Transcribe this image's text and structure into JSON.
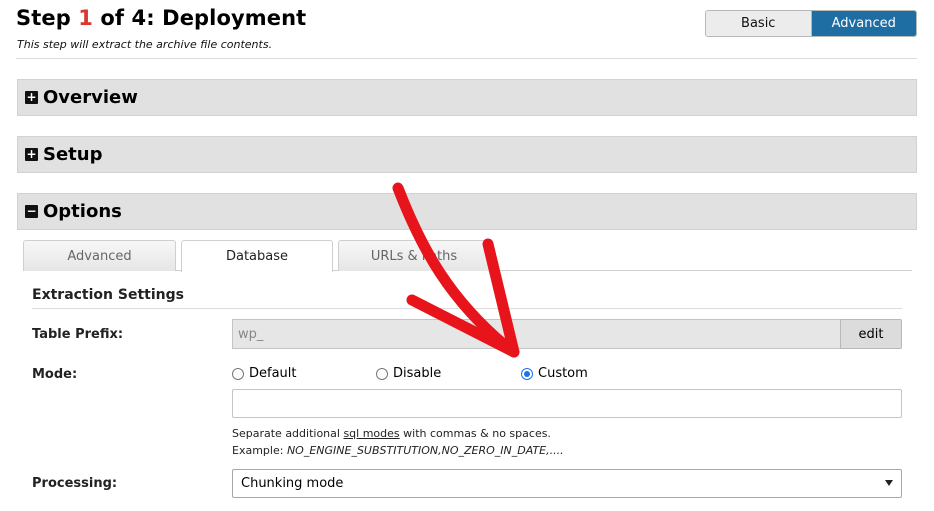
{
  "header": {
    "step_prefix": "Step ",
    "step_num": "1",
    "step_suffix": " of 4: Deployment",
    "subtitle": "This step will extract the archive file contents."
  },
  "mode_toggle": {
    "basic": "Basic",
    "advanced": "Advanced",
    "active": "Advanced"
  },
  "sections": {
    "overview": {
      "icon": "+",
      "label": "Overview"
    },
    "setup": {
      "icon": "+",
      "label": "Setup"
    },
    "options": {
      "icon": "−",
      "label": "Options"
    }
  },
  "tabs": [
    {
      "label": "Advanced",
      "active": false
    },
    {
      "label": "Database",
      "active": true
    },
    {
      "label": "URLs & Paths",
      "active": false
    }
  ],
  "extraction": {
    "title": "Extraction Settings",
    "table_prefix": {
      "label": "Table Prefix:",
      "value": "wp_",
      "edit": "edit"
    },
    "mode": {
      "label": "Mode:",
      "options": [
        "Default",
        "Disable",
        "Custom"
      ],
      "selected": "Custom",
      "custom_value": "",
      "hint_pre": "Separate additional ",
      "hint_link": "sql modes",
      "hint_post": " with commas & no spaces.",
      "example_label": "Example: ",
      "example_value": "NO_ENGINE_SUBSTITUTION,NO_ZERO_IN_DATE,...."
    },
    "processing": {
      "label": "Processing:",
      "value": "Chunking mode"
    }
  },
  "colors": {
    "accent": "#1f6ea3",
    "step_number": "#d9372f",
    "annotation_arrow": "#e8141b"
  }
}
